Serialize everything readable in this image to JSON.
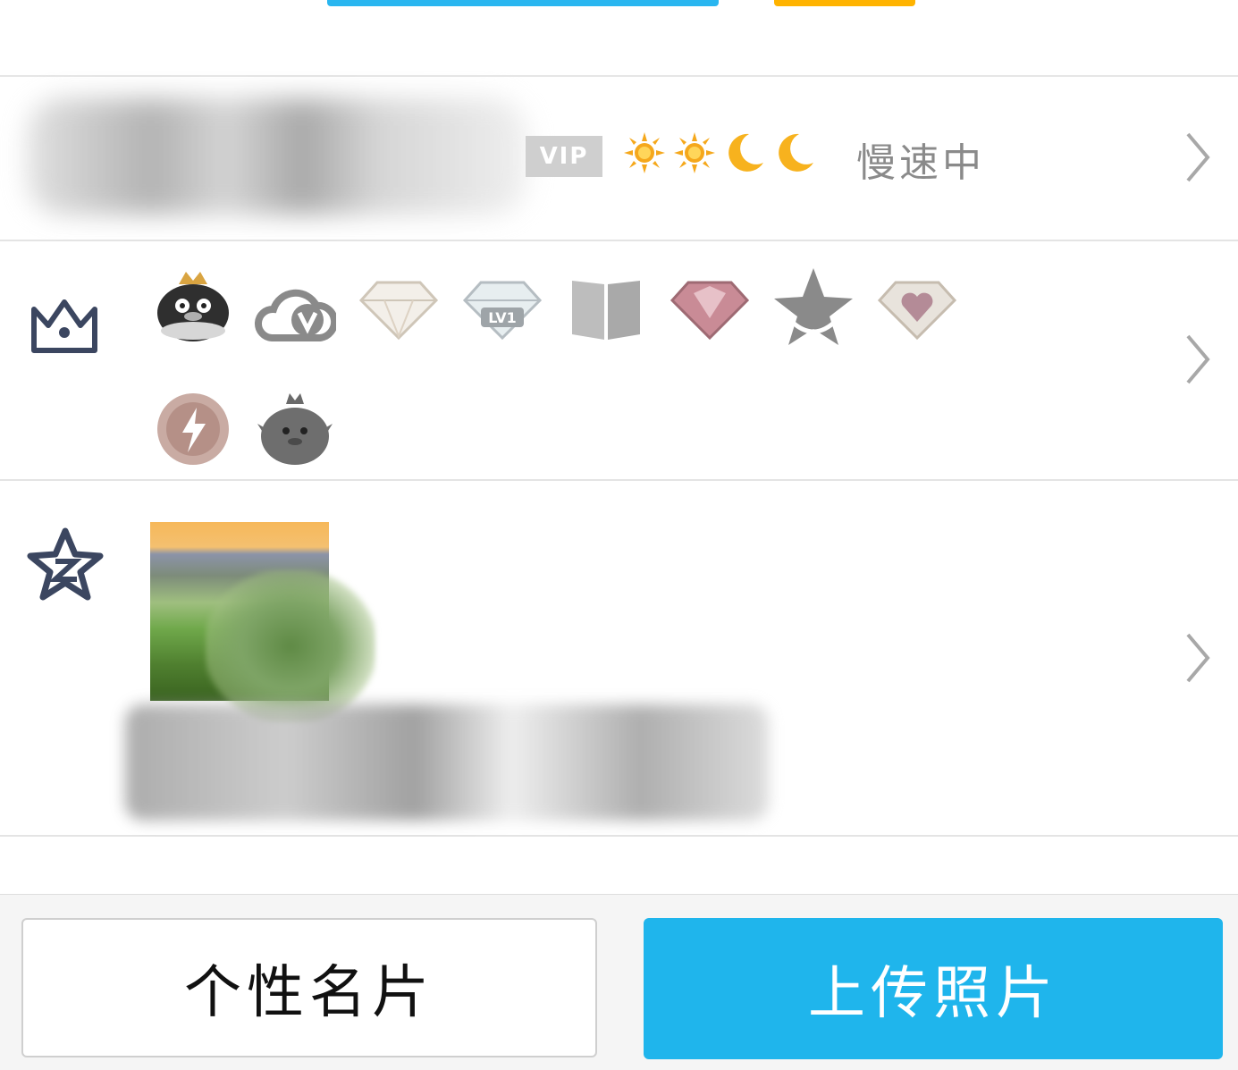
{
  "profile": {
    "vip_label": "VIP",
    "level_icons": [
      "sun-icon",
      "sun-icon",
      "moon-icon",
      "moon-icon"
    ],
    "speed_status": "慢速中"
  },
  "badges": {
    "icons": [
      "qq-penguin-crown-icon",
      "cloud-v-icon",
      "diamond-icon",
      "diamond-lv1-icon",
      "book-icon",
      "pink-gem-icon",
      "star-icon",
      "heart-gem-icon",
      "lightning-headphones-icon",
      "penguin-crown-icon"
    ],
    "lv_text": "LV1"
  },
  "colors": {
    "accent_blue": "#1fb5ec",
    "accent_orange": "#ffb300",
    "vip_gray": "#cfcfcf",
    "icon_navy": "#3b4660"
  },
  "footer": {
    "card_button_label": "个性名片",
    "upload_button_label": "上传照片"
  }
}
